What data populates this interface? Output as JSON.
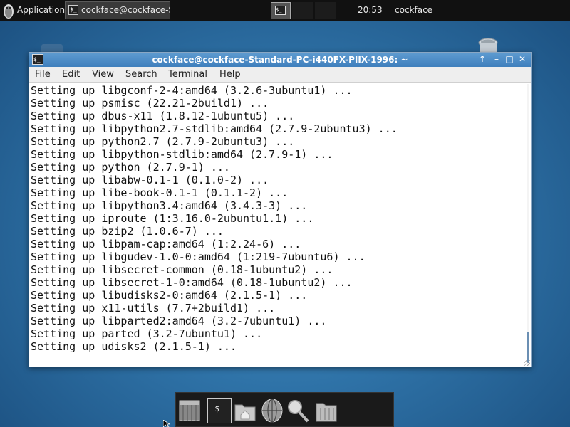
{
  "top_panel": {
    "applications_label": "Applications",
    "task_label": "cockface@cockface-Sta...",
    "terminal_glyph": "$_",
    "clock": "20:53",
    "user": "cockface"
  },
  "window": {
    "title": "cockface@cockface-Standard-PC-i440FX-PIIX-1996: ~",
    "icon_glyph": "$_",
    "controls": {
      "up": "↑",
      "minimize": "–",
      "maximize": "□",
      "close": "✕"
    },
    "menu": [
      "File",
      "Edit",
      "View",
      "Search",
      "Terminal",
      "Help"
    ]
  },
  "terminal": {
    "lines": [
      "Setting up libgconf-2-4:amd64 (3.2.6-3ubuntu1) ...",
      "Setting up psmisc (22.21-2build1) ...",
      "Setting up dbus-x11 (1.8.12-1ubuntu5) ...",
      "Setting up libpython2.7-stdlib:amd64 (2.7.9-2ubuntu3) ...",
      "Setting up python2.7 (2.7.9-2ubuntu3) ...",
      "Setting up libpython-stdlib:amd64 (2.7.9-1) ...",
      "Setting up python (2.7.9-1) ...",
      "Setting up libabw-0.1-1 (0.1.0-2) ...",
      "Setting up libe-book-0.1-1 (0.1.1-2) ...",
      "Setting up libpython3.4:amd64 (3.4.3-3) ...",
      "Setting up iproute (1:3.16.0-2ubuntu1.1) ...",
      "Setting up bzip2 (1.0.6-7) ...",
      "Setting up libpam-cap:amd64 (1:2.24-6) ...",
      "Setting up libgudev-1.0-0:amd64 (1:219-7ubuntu6) ...",
      "Setting up libsecret-common (0.18-1ubuntu2) ...",
      "Setting up libsecret-1-0:amd64 (0.18-1ubuntu2) ...",
      "Setting up libudisks2-0:amd64 (2.1.5-1) ...",
      "Setting up x11-utils (7.7+2build1) ...",
      "Setting up libparted2:amd64 (3.2-7ubuntu1) ...",
      "Setting up parted (3.2-7ubuntu1) ...",
      "Setting up udisks2 (2.1.5-1) ..."
    ]
  },
  "dock": {
    "terminal_glyph": "$_",
    "items": [
      "desktop-icon",
      "terminal-icon",
      "home-folder-icon",
      "web-browser-icon",
      "search-icon",
      "files-icon"
    ]
  },
  "colors": {
    "title_bar": "#4a8ac5",
    "panel": "#111111",
    "desktop": "#2f73a8",
    "scroll_thumb": "#6b8fb3"
  }
}
